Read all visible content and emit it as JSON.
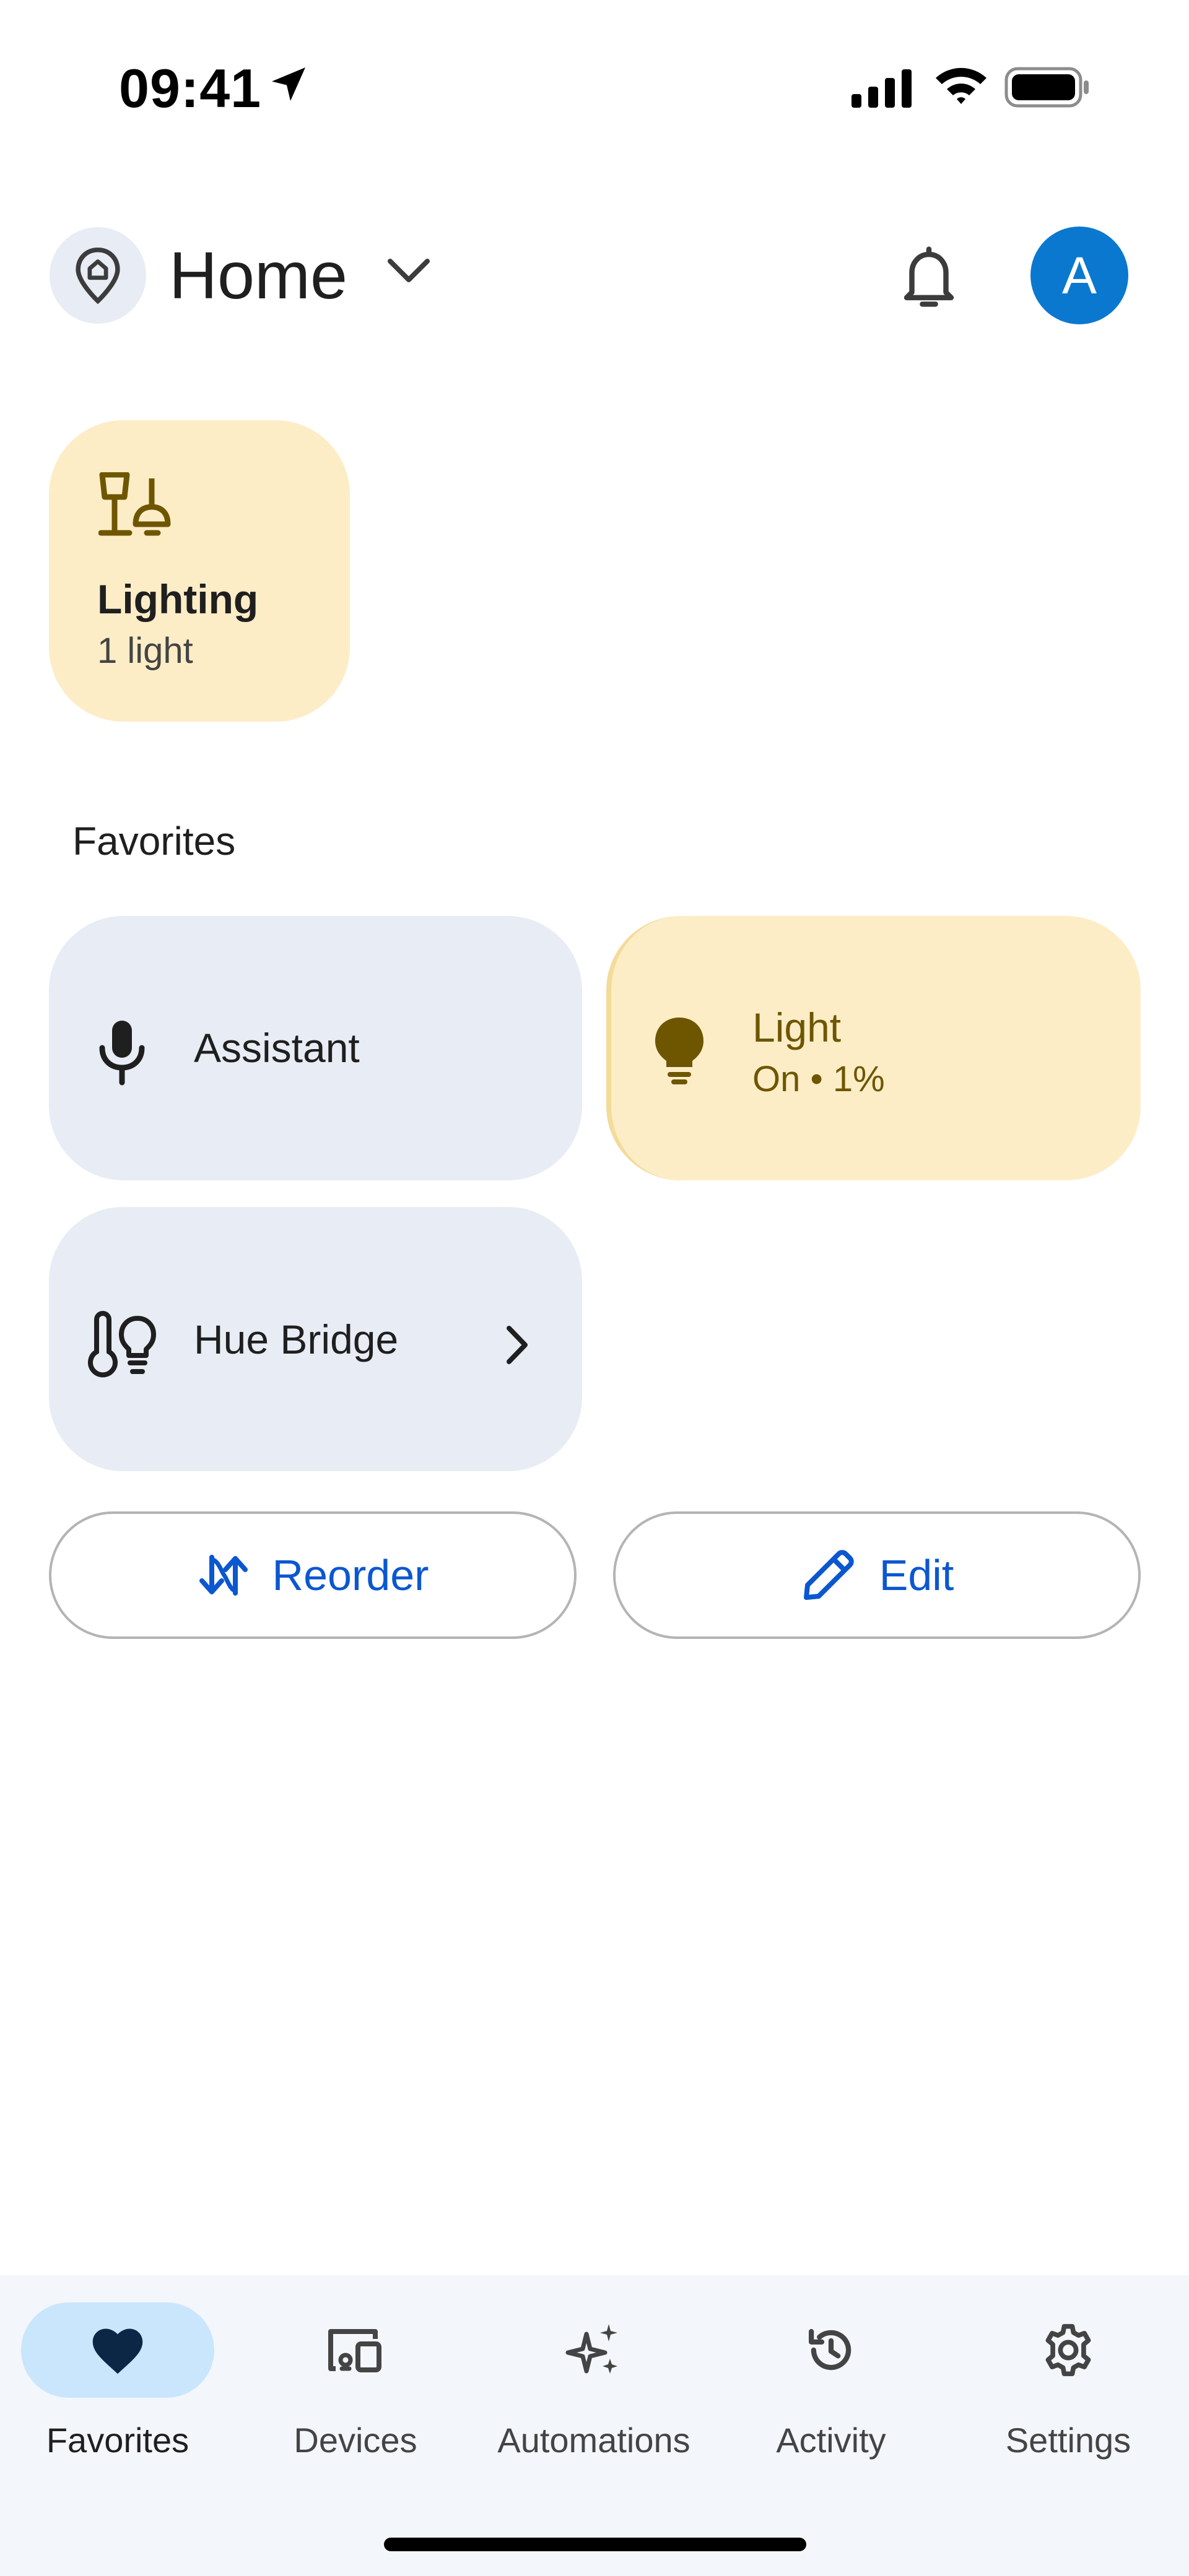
{
  "status_bar": {
    "time": "09:41"
  },
  "header": {
    "home_title": "Home",
    "avatar_initial": "A"
  },
  "lighting": {
    "label": "Lighting",
    "sub": "1 light"
  },
  "favorites": {
    "title": "Favorites",
    "assistant_label": "Assistant",
    "light_label": "Light",
    "light_status": "On • 1%",
    "hue_label": "Hue Bridge"
  },
  "buttons": {
    "reorder": "Reorder",
    "edit": "Edit"
  },
  "nav": {
    "items": [
      {
        "label": "Favorites"
      },
      {
        "label": "Devices"
      },
      {
        "label": "Automations"
      },
      {
        "label": "Activity"
      },
      {
        "label": "Settings"
      }
    ]
  },
  "colors": {
    "accent_blue": "#0b57d0",
    "avatar_blue": "#0b78d0",
    "lighting_tile": "#fdedc7",
    "neutral_tile": "#e8ecf4",
    "nav_active": "#c9e6fc"
  }
}
